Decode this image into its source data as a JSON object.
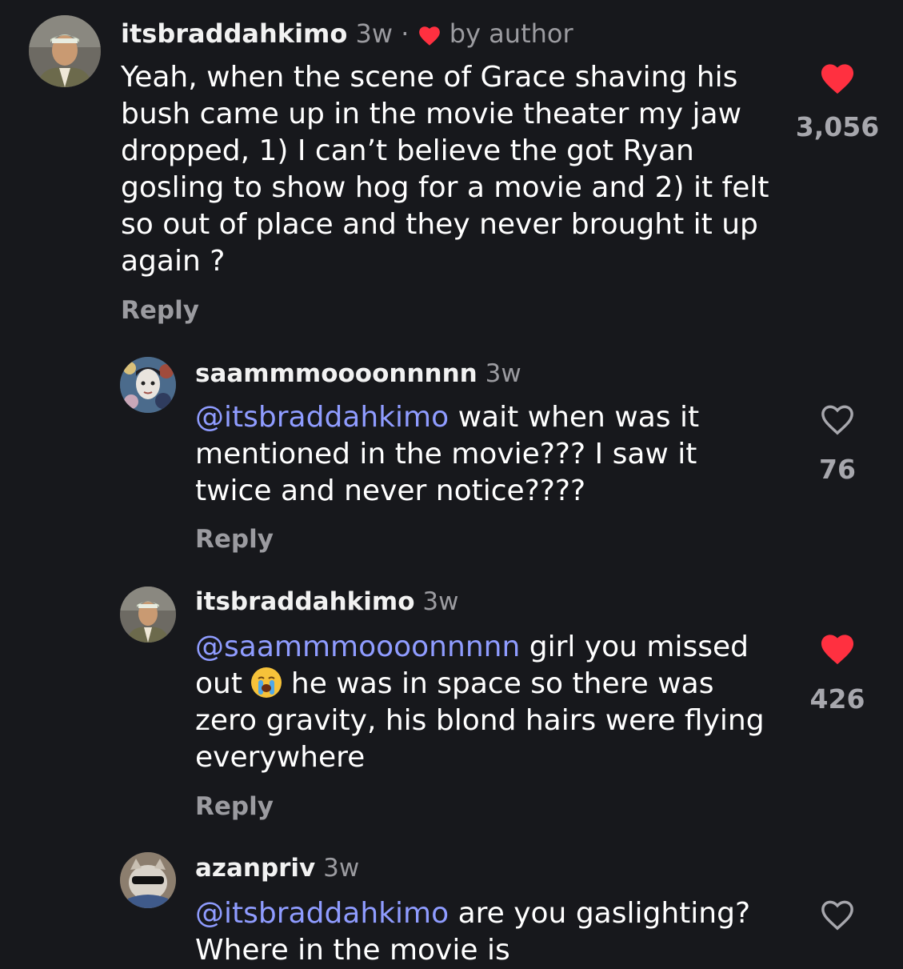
{
  "colors": {
    "background": "#17181c",
    "mention": "#8f9cff",
    "liked_heart": "#ff3040",
    "muted": "#9b9ba0"
  },
  "comments": [
    {
      "username": "itsbraddahkimo",
      "time": "3w",
      "separator": "·",
      "badge_icon": "heart-icon",
      "badge_text": "by author",
      "mention": "",
      "text": "Yeah, when the scene of Grace shaving his bush came up in the movie theater my jaw dropped, 1) I can’t believe the got Ryan gosling to show hog for a movie and 2) it felt so out of place and they never brought it up again ?",
      "reply_label": "Reply",
      "liked": true,
      "like_count": "3,056"
    },
    {
      "username": "saammmoooonnnnn",
      "time": "3w",
      "mention": "@itsbraddahkimo",
      "text": "wait when was it mentioned in the movie??? I saw it twice and never notice????",
      "reply_label": "Reply",
      "liked": false,
      "like_count": "76"
    },
    {
      "username": "itsbraddahkimo",
      "time": "3w",
      "mention": "@saammmoooonnnnn",
      "text_before_emoji": "girl you missed out",
      "emoji": "loudly-crying-face-emoji",
      "text_after_emoji": "he was in space so there was zero gravity, his blond hairs were flying everywhere",
      "reply_label": "Reply",
      "liked": true,
      "like_count": "426"
    },
    {
      "username": "azanpriv",
      "time": "3w",
      "mention": "@itsbraddahkimo",
      "text": "are you gaslighting? Where in the movie is",
      "liked": false
    }
  ]
}
